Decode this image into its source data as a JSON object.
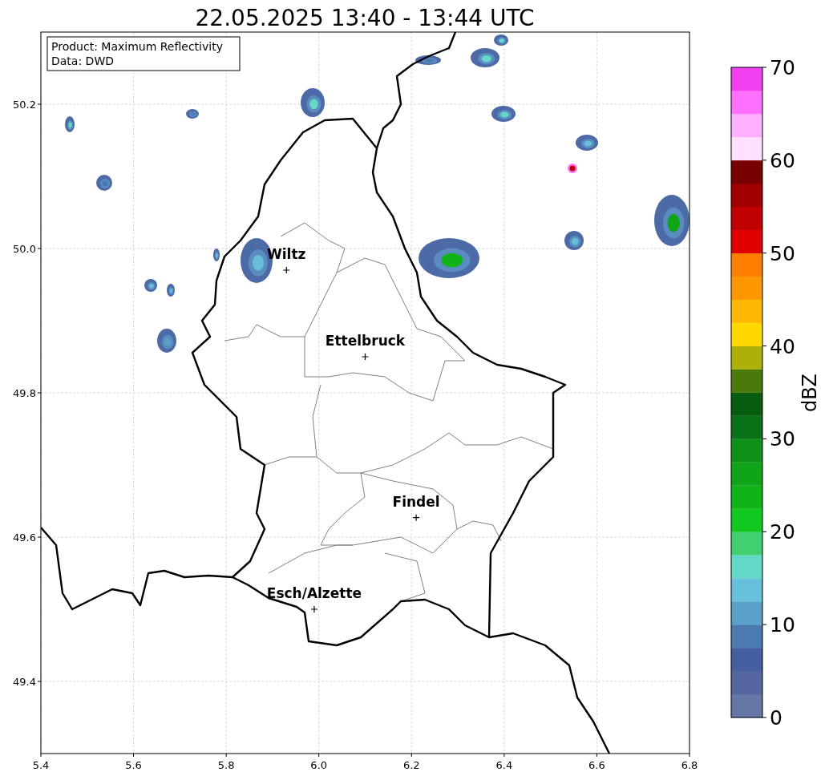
{
  "title": "22.05.2025 13:40 - 13:44 UTC",
  "info_box": [
    "Product: Maximum Reflectivity",
    "Data: DWD"
  ],
  "map": {
    "chart_data": {
      "type": "scatter",
      "xlim": [
        5.4,
        6.8
      ],
      "ylim": [
        49.3,
        50.3
      ],
      "grid": true,
      "xticks": [
        {
          "value": 5.4,
          "label": "5.4"
        },
        {
          "value": 5.6,
          "label": "5.6"
        },
        {
          "value": 5.8,
          "label": "5.8"
        },
        {
          "value": 6.0,
          "label": "6.0"
        },
        {
          "value": 6.2,
          "label": "6.2"
        },
        {
          "value": 6.4,
          "label": "6.4"
        },
        {
          "value": 6.6,
          "label": "6.6"
        },
        {
          "value": 6.8,
          "label": "6.8"
        }
      ],
      "yticks": [
        {
          "value": 50.2,
          "label": "50.2"
        },
        {
          "value": 50.0,
          "label": "50.0"
        },
        {
          "value": 49.8,
          "label": "49.8"
        },
        {
          "value": 49.6,
          "label": "49.6"
        },
        {
          "value": 49.4,
          "label": "49.4"
        }
      ],
      "series": [
        {
          "color": "#000000",
          "x": [
            5.93,
            6.1,
            6.21,
            5.99
          ],
          "values": [
            49.97,
            49.85,
            49.627,
            49.5
          ]
        }
      ],
      "annotations": [
        {
          "text": "Wiltz",
          "x": 5.93,
          "y": 49.97
        },
        {
          "text": "Ettelbruck",
          "x": 6.1,
          "y": 49.85
        },
        {
          "text": "Findel",
          "x": 6.21,
          "y": 49.627
        },
        {
          "text": "Esch/Alzette",
          "x": 5.99,
          "y": 49.5
        }
      ]
    }
  },
  "colorbar": {
    "label": "dBZ",
    "ticks": [
      "70",
      "60",
      "50",
      "40",
      "30",
      "20",
      "10",
      "0"
    ]
  }
}
